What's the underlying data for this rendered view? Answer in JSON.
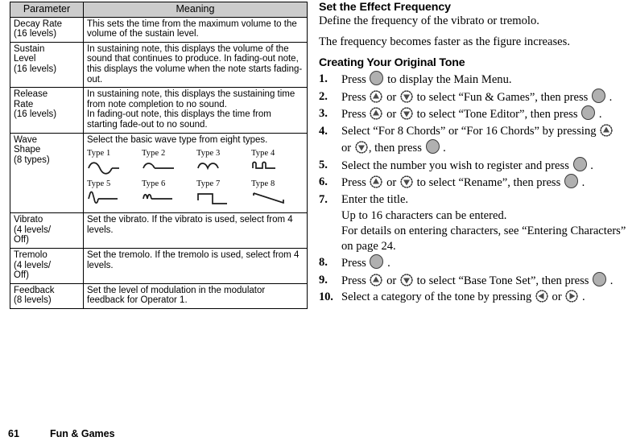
{
  "table": {
    "headers": [
      "Parameter",
      "Meaning"
    ],
    "rows": [
      {
        "parameter": "Decay Rate\n(16 levels)",
        "meaning": "This sets the time from the maximum volume to the volume of the sustain level."
      },
      {
        "parameter": "Sustain\nLevel\n(16 levels)",
        "meaning": "In sustaining note, this displays the volume of the sound that continues to produce. In fading-out note, this displays the volume when the note starts fading-out."
      },
      {
        "parameter": "Release\nRate\n(16 levels)",
        "meaning": "In sustaining note, this displays the sustaining time from note completion to no sound.\nIn fading-out note, this displays the time from starting fade-out to no sound."
      },
      {
        "parameter": "Wave\nShape\n(8 types)",
        "meaning": "Select the basic wave type from eight types.",
        "waves": [
          {
            "label": "Type 1",
            "shape": "sine"
          },
          {
            "label": "Type 2",
            "shape": "half-sine"
          },
          {
            "label": "Type 3",
            "shape": "abs-sine"
          },
          {
            "label": "Type 4",
            "shape": "pulse-sine"
          },
          {
            "label": "Type 5",
            "shape": "half-sine-flat"
          },
          {
            "label": "Type 6",
            "shape": "double-bump"
          },
          {
            "label": "Type 7",
            "shape": "square"
          },
          {
            "label": "Type 8",
            "shape": "saw-down"
          }
        ]
      },
      {
        "parameter": "Vibrato\n(4 levels/\nOff)",
        "meaning": "Set the vibrato. If the vibrato is used, select from 4 levels."
      },
      {
        "parameter": "Tremolo\n(4 levels/\nOff)",
        "meaning": "Set the tremolo. If the tremolo is used, select from 4 levels."
      },
      {
        "parameter": "Feedback\n(8 levels)",
        "meaning": "Set the level of modulation in the modulator feedback for Operator 1."
      }
    ]
  },
  "right": {
    "heading1": "Set the Effect Frequency",
    "para1": "Define the frequency of the vibrato or tremolo.",
    "para2": "The frequency becomes faster as the figure increases.",
    "heading2": "Creating Your Original Tone",
    "steps": [
      {
        "num": "1.",
        "parts": [
          {
            "t": "text",
            "v": "Press "
          },
          {
            "t": "icon",
            "v": "center-key-icon"
          },
          {
            "t": "text",
            "v": " to display the Main Menu."
          }
        ]
      },
      {
        "num": "2.",
        "parts": [
          {
            "t": "text",
            "v": "Press "
          },
          {
            "t": "icon",
            "v": "up-key-icon"
          },
          {
            "t": "text",
            "v": " or "
          },
          {
            "t": "icon",
            "v": "down-key-icon"
          },
          {
            "t": "text",
            "v": " to select “Fun & Games”, then press "
          },
          {
            "t": "icon",
            "v": "center-key-icon"
          },
          {
            "t": "text",
            "v": " ."
          }
        ]
      },
      {
        "num": "3.",
        "parts": [
          {
            "t": "text",
            "v": "Press "
          },
          {
            "t": "icon",
            "v": "up-key-icon"
          },
          {
            "t": "text",
            "v": " or "
          },
          {
            "t": "icon",
            "v": "down-key-icon"
          },
          {
            "t": "text",
            "v": " to select “Tone Editor”, then press "
          },
          {
            "t": "icon",
            "v": "center-key-icon"
          },
          {
            "t": "text",
            "v": " ."
          }
        ]
      },
      {
        "num": "4.",
        "parts": [
          {
            "t": "text",
            "v": "Select “For 8 Chords” or “For 16 Chords” by pressing "
          },
          {
            "t": "icon",
            "v": "up-key-icon"
          },
          {
            "t": "text",
            "v": " or "
          },
          {
            "t": "icon",
            "v": "down-key-icon"
          },
          {
            "t": "text",
            "v": ", then press "
          },
          {
            "t": "icon",
            "v": "center-key-icon"
          },
          {
            "t": "text",
            "v": " ."
          }
        ]
      },
      {
        "num": "5.",
        "parts": [
          {
            "t": "text",
            "v": "Select the number you wish to register and press "
          },
          {
            "t": "icon",
            "v": "center-key-icon"
          },
          {
            "t": "text",
            "v": " ."
          }
        ]
      },
      {
        "num": "6.",
        "parts": [
          {
            "t": "text",
            "v": "Press "
          },
          {
            "t": "icon",
            "v": "up-key-icon"
          },
          {
            "t": "text",
            "v": " or "
          },
          {
            "t": "icon",
            "v": "down-key-icon"
          },
          {
            "t": "text",
            "v": " to select “Rename”, then press "
          },
          {
            "t": "icon",
            "v": "center-key-icon"
          },
          {
            "t": "text",
            "v": " ."
          }
        ]
      },
      {
        "num": "7.",
        "parts": [
          {
            "t": "text",
            "v": "Enter the title."
          }
        ],
        "sub": "Up to 16 characters can be entered.\nFor details on entering characters, see “Entering Characters” on page 24."
      },
      {
        "num": "8.",
        "parts": [
          {
            "t": "text",
            "v": "Press "
          },
          {
            "t": "icon",
            "v": "center-key-icon"
          },
          {
            "t": "text",
            "v": " ."
          }
        ]
      },
      {
        "num": "9.",
        "parts": [
          {
            "t": "text",
            "v": "Press "
          },
          {
            "t": "icon",
            "v": "up-key-icon"
          },
          {
            "t": "text",
            "v": " or "
          },
          {
            "t": "icon",
            "v": "down-key-icon"
          },
          {
            "t": "text",
            "v": " to select “Base Tone Set”, then press "
          },
          {
            "t": "icon",
            "v": "center-key-icon"
          },
          {
            "t": "text",
            "v": " ."
          }
        ]
      },
      {
        "num": "10.",
        "parts": [
          {
            "t": "text",
            "v": "Select a category of the tone by pressing "
          },
          {
            "t": "icon",
            "v": "left-key-icon"
          },
          {
            "t": "text",
            "v": " or "
          },
          {
            "t": "icon",
            "v": "right-key-icon"
          },
          {
            "t": "text",
            "v": " ."
          }
        ]
      }
    ]
  },
  "footer": {
    "page_number": "61",
    "section": "Fun & Games"
  },
  "colors": {
    "header_bg": "#cccccc",
    "key_fill": "#b0b0b0",
    "border": "#000000"
  }
}
